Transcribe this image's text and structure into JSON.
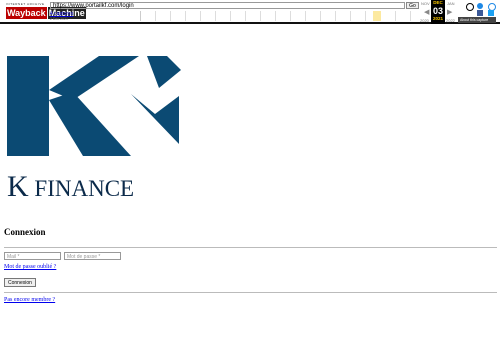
{
  "wayback": {
    "logo_top": "INTERNET ARCHIVE",
    "logo_word_1": "Wayback",
    "logo_word_2": "Machine",
    "url": "https://www.portailkf.com/login",
    "go_label": "Go",
    "captures": "4 captures",
    "capture_dates": "2 Dec 2021",
    "months": {
      "prev": "NOV",
      "current": "DEC",
      "next": "JAN"
    },
    "current_day": "03",
    "years": {
      "prev": "2020",
      "current": "2021",
      "next": "2022"
    },
    "about_label": "About this capture",
    "icons": [
      "user-icon",
      "help-icon",
      "share-icon",
      "facebook-icon",
      "twitter-icon"
    ]
  },
  "brand": {
    "name_first": "K",
    "name_rest": " FINANCE",
    "color": "#0b4a73"
  },
  "login": {
    "title": "Connexion",
    "mail_placeholder": "Mail *",
    "password_placeholder": "Mot de passe *",
    "forgot_link": "Mot de passe oublié ?",
    "submit_label": "Connexion",
    "signup_link": "Pas encore membre ?"
  }
}
